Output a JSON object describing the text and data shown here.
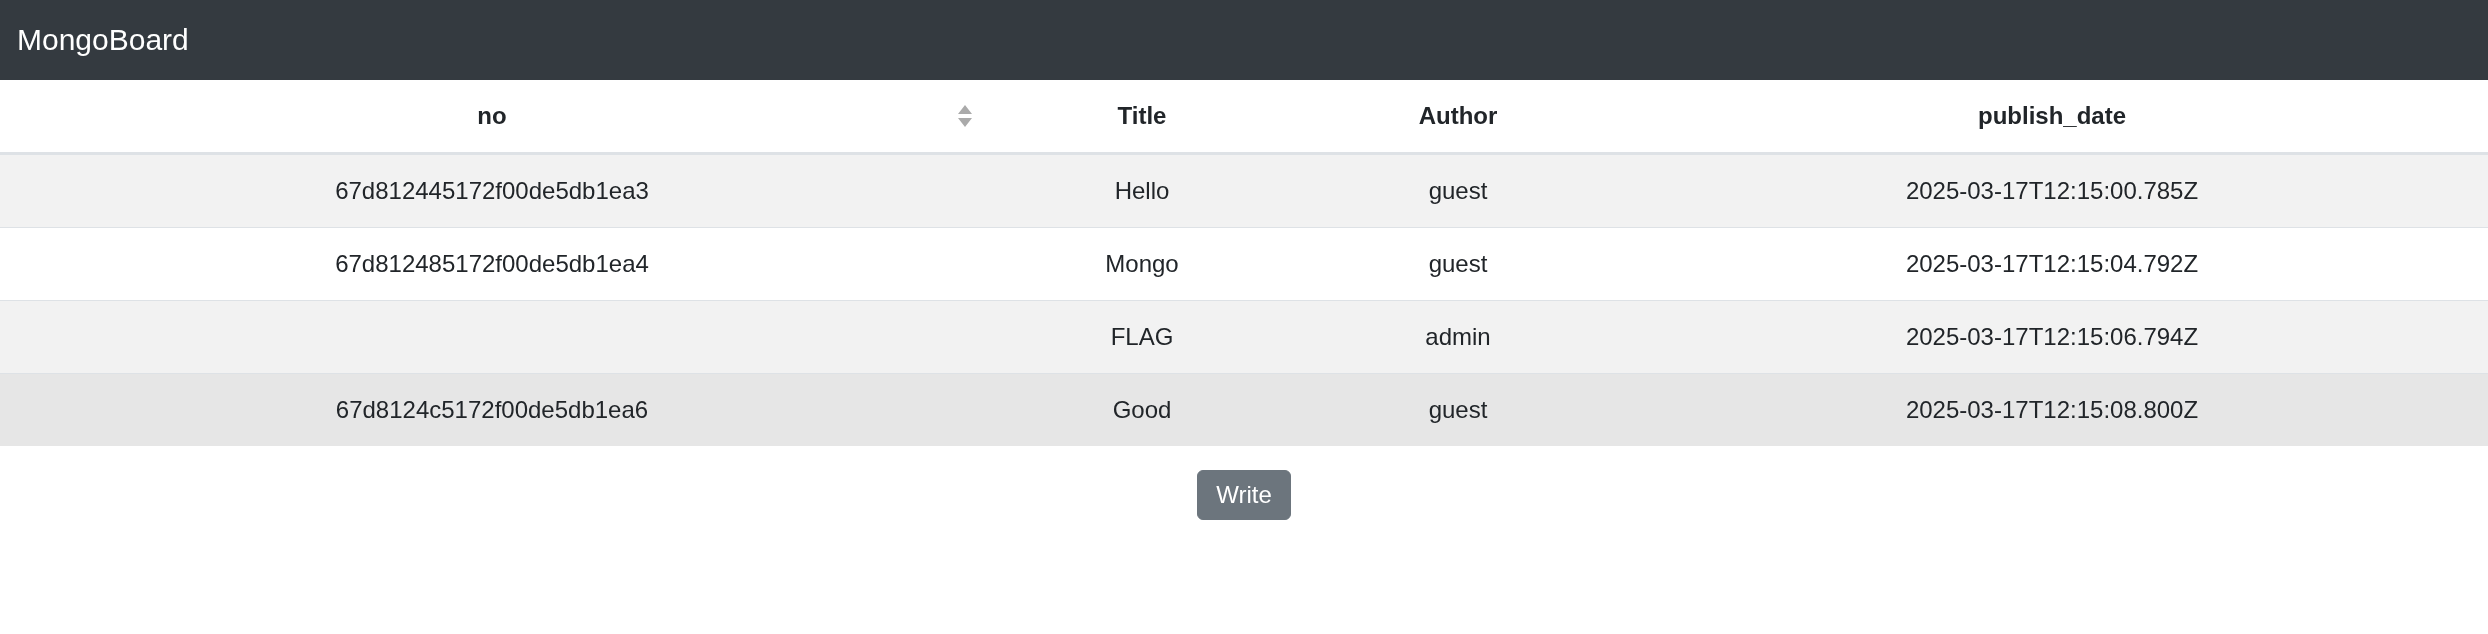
{
  "navbar": {
    "brand": "MongoBoard"
  },
  "table": {
    "columns": [
      {
        "label": "no",
        "sortable": true
      },
      {
        "label": "Title",
        "sortable": false
      },
      {
        "label": "Author",
        "sortable": false
      },
      {
        "label": "publish_date",
        "sortable": false
      }
    ],
    "rows": [
      {
        "no": "67d812445172f00de5db1ea3",
        "title": "Hello",
        "author": "guest",
        "publish_date": "2025-03-17T12:15:00.785Z",
        "hovered": false
      },
      {
        "no": "67d812485172f00de5db1ea4",
        "title": "Mongo",
        "author": "guest",
        "publish_date": "2025-03-17T12:15:04.792Z",
        "hovered": false
      },
      {
        "title": "FLAG",
        "author": "admin",
        "publish_date": "2025-03-17T12:15:06.794Z",
        "hovered": false
      },
      {
        "no": "67d8124c5172f00de5db1ea6",
        "title": "Good",
        "author": "guest",
        "publish_date": "2025-03-17T12:15:08.800Z",
        "hovered": true
      }
    ]
  },
  "write_button": "Write"
}
